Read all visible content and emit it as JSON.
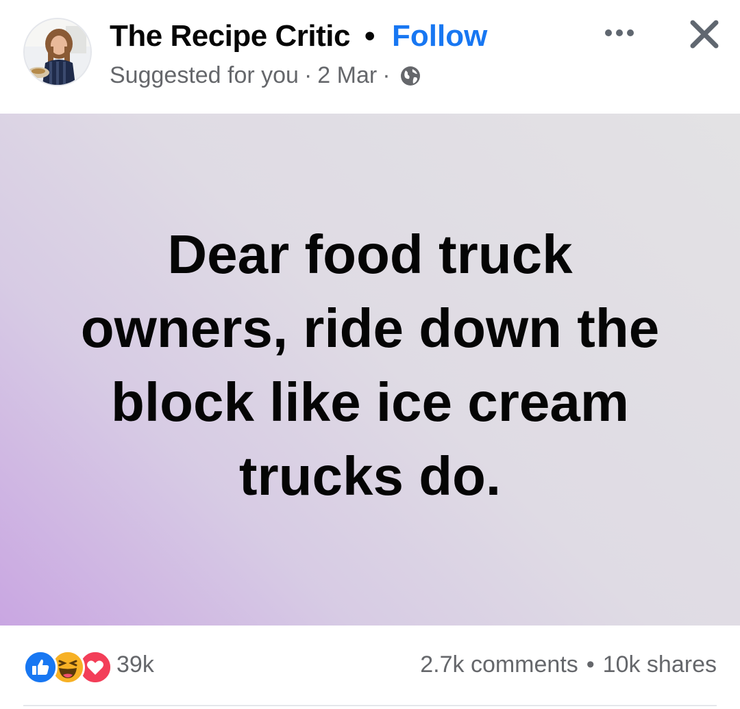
{
  "header": {
    "page_name": "The Recipe Critic",
    "name_separator": "•",
    "follow_label": "Follow",
    "suggested_label": "Suggested for you",
    "meta_separator": "·",
    "date": "2 Mar",
    "privacy_icon": "globe-icon",
    "more_icon": "more-options-icon",
    "close_icon": "close-icon"
  },
  "post": {
    "message": "Dear food truck owners, ride down the block like ice cream trucks do.",
    "background_gradient": [
      "#c9a6e2",
      "#e3e2e4"
    ]
  },
  "reactions": {
    "icons": [
      "like-icon",
      "haha-icon",
      "love-icon"
    ],
    "count": "39k",
    "comments": "2.7k comments",
    "engagement_separator": "•",
    "shares": "10k shares"
  },
  "colors": {
    "accent": "#1877f2",
    "secondary_text": "#65676b",
    "primary_text": "#050505",
    "like": "#1877f2",
    "love": "#f33e58",
    "haha": "#f7b125"
  }
}
